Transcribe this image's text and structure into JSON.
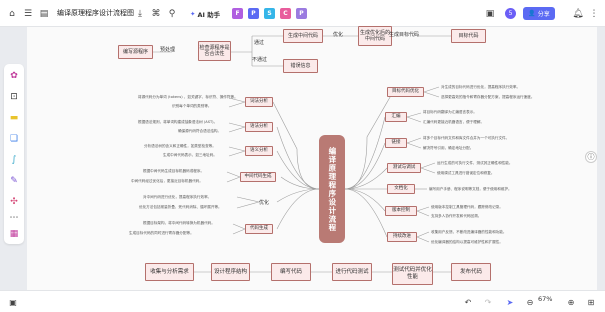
{
  "header": {
    "title": "编译原理程序设计流程图",
    "ai_label": "AI 助手",
    "share_label": "分享",
    "avatar_letter": "5",
    "app_badges": [
      "F",
      "P",
      "S",
      "C",
      "P"
    ]
  },
  "flow_top": {
    "start": "编写源程序",
    "check": "检查源程序是否合法性",
    "pre_analysis": "预处理",
    "branch_yes": "通过",
    "branch_no": "不通过",
    "gen_mid": "生成中间代码",
    "optimize": "优化",
    "optimized_mid": "生成优化后的中间代码",
    "gen_target": "生成目标代码",
    "target": "目标代码",
    "error": "错误信息"
  },
  "center": {
    "title": "编译原理程序设计流程"
  },
  "left_branches": [
    {
      "label": "词法分析",
      "leaves": [
        "将源代码分为单词 (tokens) ，如关键字、标识符、操作符等。",
        "识别每个单词的类别等。"
      ]
    },
    {
      "label": "语法分析",
      "leaves": [
        "根据语法规则，将单词构建成抽象语法树 (AST)。",
        "确保源代码符合语法结构。"
      ]
    },
    {
      "label": "语义分析",
      "leaves": [
        "分析语法树的含义和正确性，如类型检查等。",
        "生成中间代码表示，如三地址码。"
      ]
    },
    {
      "label": "中间代码生成",
      "leaves": [
        "根据中间代码生成目标机器码或程序。",
        "中间代码经过优化后，更接近目标机器代码。"
      ]
    },
    {
      "label": "优化",
      "leaves": [
        "对中间代码进行优化，提高程序执行效率。",
        "优化方法包括常量折叠、死代码消除、循环展开等。"
      ]
    },
    {
      "label": "代码生成",
      "leaves": [
        "根据目标架构，将中间代码转换为机器代码。",
        "生成目标代码的同时进行寄存器分配等。"
      ]
    }
  ],
  "right_branches": [
    {
      "label": "目标代码优化",
      "leaves": [
        "对生成的目标代码进行优化，提高程序执行效率。",
        "选择更高效的指令和寄存器分配方案，提高程序运行速度。"
      ]
    },
    {
      "label": "汇编",
      "leaves": [
        "将目标代码翻译为汇编语言表示。",
        "汇编代码更接近机器语言，便于理解。"
      ]
    },
    {
      "label": "链接",
      "leaves": [
        "将多个目标代码文件和库文件合并为一个可执行文件。",
        "解决符号引用，确定地址分配。"
      ]
    },
    {
      "label": "测试与调试",
      "leaves": [
        "运行生成的可执行文件，测试其正确性和性能。",
        "使用调试工具进行错误定位和修复。"
      ]
    },
    {
      "label": "文档化",
      "leaves": [
        "编写用户手册、程序说明等文档，便于使用和维护。"
      ]
    },
    {
      "label": "版本控制",
      "leaves": [
        "使用版本控制工具管理代码，跟踪修改记录。",
        "支持多人协作开发和代码回溯。"
      ]
    },
    {
      "label": "持续改进",
      "leaves": [
        "收集用户反馈，不断改进编译器的性能和功能。",
        "优化编译器的结构以提高可维护性和扩展性。"
      ]
    }
  ],
  "flow_bottom": [
    "收集与分析需求",
    "设计程序结构",
    "编写代码",
    "进行代码测试",
    "测试代码并优化性能",
    "发布代码"
  ],
  "bottom": {
    "zoom": "67%"
  }
}
